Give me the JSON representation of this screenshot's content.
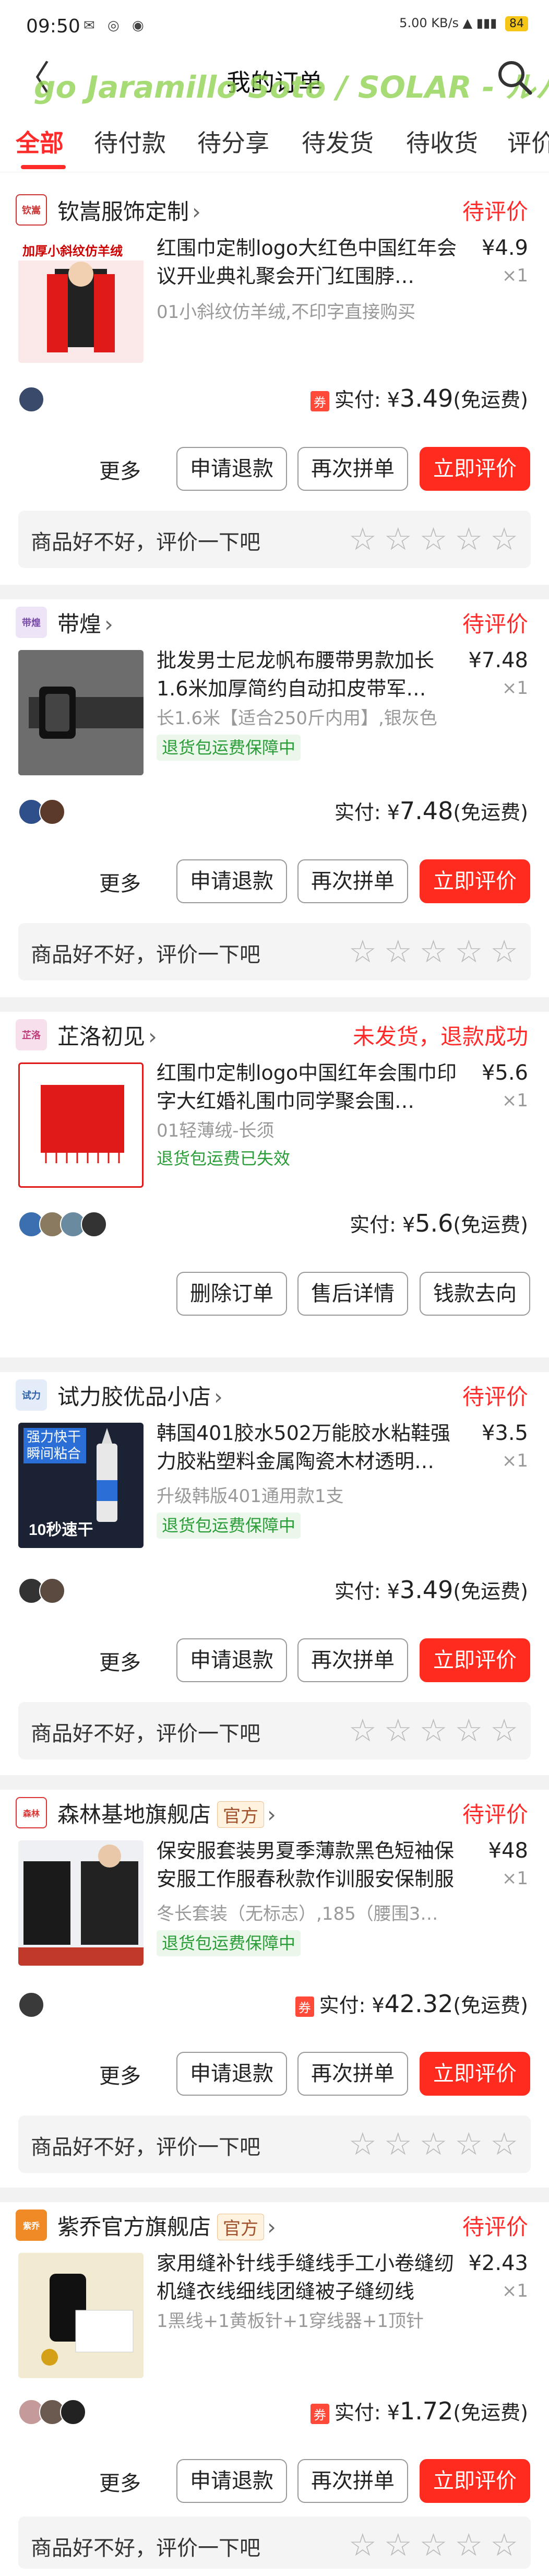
{
  "status_bar": {
    "time": "09:50",
    "battery": "84",
    "network": "5.00 KB/s"
  },
  "nav": {
    "back_glyph": "〈",
    "title": "我的订单",
    "marquee": "go Jaramillo Soto / SOLAR - ルバ"
  },
  "tabs": [
    "全部",
    "待付款",
    "待分享",
    "待发货",
    "待收货",
    "评价"
  ],
  "common": {
    "more": "更多",
    "refund": "申请退款",
    "rebuy": "再次拼单",
    "review": "立即评价",
    "prompt": "商品好不好，评价一下吧",
    "paid_label": "实付: ",
    "currency": "¥",
    "free_ship": "(免运费)",
    "coupon": "券",
    "qty": "×1"
  },
  "orders": [
    {
      "shop": "钦嵩服饰定制",
      "status": "待评价",
      "title": "红围巾定制logo大红色中国红年会议开业典礼聚会开门红围脖…",
      "price": "¥4.9",
      "spec": "01小斜纹仿羊绒,不印字直接购买",
      "paid": "3.49",
      "thumb_text": "加厚小斜纹仿羊绒"
    },
    {
      "shop": "带煌",
      "status": "待评价",
      "title": "批发男士尼龙帆布腰带男款加长1.6米加厚简约自动扣皮带军…",
      "price": "¥7.48",
      "spec": "长1.6米【适合250斤内用】,银灰色",
      "badge": "退货包运费保障中",
      "paid": "7.48"
    },
    {
      "shop": "芷洛初见",
      "status": "未发货，退款成功",
      "title": "红围巾定制logo中国红年会围巾印字大红婚礼围巾同学聚会围…",
      "price": "¥5.6",
      "spec": "01轻薄绒-长须",
      "badge": "退货包运费已失效",
      "paid": "5.6",
      "buttons": [
        "删除订单",
        "售后详情",
        "钱款去向"
      ]
    },
    {
      "shop": "试力胶优品小店",
      "status": "待评价",
      "title": "韩国401胶水502万能胶水粘鞋强力胶粘塑料金属陶瓷木材透明…",
      "price": "¥3.5",
      "spec": "升级韩版401通用款1支",
      "badge": "退货包运费保障中",
      "paid": "3.49",
      "thumb_text": "强力快干 瞬间粘合"
    },
    {
      "shop": "森林基地旗舰店",
      "official": "官方",
      "status": "待评价",
      "title": "保安服套装男夏季薄款黑色短袖保安服工作服春秋款作训服安保制服",
      "price": "¥48",
      "spec": "冬长套装（无标志）,185（腰围3…",
      "badge": "退货包运费保障中",
      "paid": "42.32"
    },
    {
      "shop": "紫乔官方旗舰店",
      "official": "官方",
      "status": "待评价",
      "title": "家用缝补针线手缝线手工小卷缝纫机缝衣线细线团缝被子缝纫线",
      "price": "¥2.43",
      "spec": "1黑线+1黄板针+1穿线器+1顶针",
      "paid": "1.72"
    }
  ],
  "colors": {
    "accent": "#ff2b2b",
    "green": "#2a9d38",
    "bg": "#f2f2f2"
  }
}
